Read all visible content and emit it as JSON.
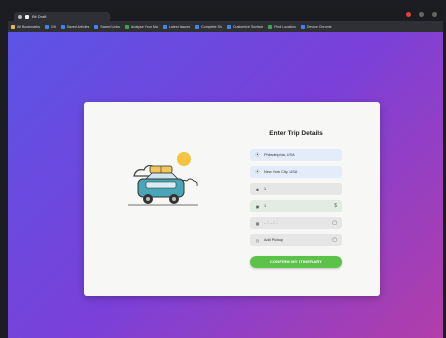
{
  "browser": {
    "tab_title": "Bit Draft",
    "bookmarks": [
      {
        "label": "All Bookmarks",
        "color": "#e9b949"
      },
      {
        "label": "Gif",
        "color": "#3c8ce7"
      },
      {
        "label": "Saved Articles",
        "color": "#4285f4"
      },
      {
        "label": "Saved Links",
        "color": "#4285f4"
      },
      {
        "label": "Analyse Your Ma",
        "color": "#34a853"
      },
      {
        "label": "Latest Issues",
        "color": "#4285f4"
      },
      {
        "label": "Complete Sh",
        "color": "#4285f4"
      },
      {
        "label": "Customize Surface",
        "color": "#4285f4"
      },
      {
        "label": "Find Location",
        "color": "#34a853"
      },
      {
        "label": "Device Chrome",
        "color": "#4285f4"
      }
    ]
  },
  "trip_form": {
    "title": "Enter Trip Details",
    "from": {
      "icon": "pin-icon",
      "value": "Philadelphia, USA"
    },
    "to": {
      "icon": "pin-icon",
      "value": "New York City, USA"
    },
    "passengers": {
      "icon": "people-icon",
      "value": "1"
    },
    "luggage": {
      "icon": "bag-icon",
      "value": "1",
      "tail": "$"
    },
    "date": {
      "icon": "calendar-icon",
      "placeholder": "-- / -- / --",
      "tail": "▢"
    },
    "time": {
      "icon": "clock-icon",
      "value": "Add Pickup",
      "tail": "▢"
    },
    "submit_label": "CONFIRM MY ITINERARY"
  },
  "colors": {
    "accent_green": "#5cc24a",
    "gradient_start": "#5b54e6",
    "gradient_end": "#b23ea9"
  }
}
